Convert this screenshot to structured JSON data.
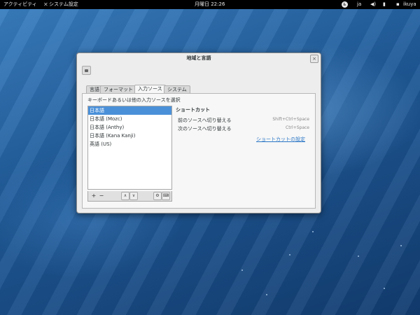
{
  "topbar": {
    "activities": "アクティビティ",
    "app_name": "システム設定",
    "clock": "月曜日 22:26",
    "input_lang": "ja",
    "user": "ikuya"
  },
  "window": {
    "title": "地域と言語",
    "close_glyph": "×"
  },
  "tabs": [
    {
      "label": "言語",
      "active": false
    },
    {
      "label": "フォーマット",
      "active": false
    },
    {
      "label": "入力ソース",
      "active": true
    },
    {
      "label": "システム",
      "active": false
    }
  ],
  "input_sources": {
    "instruction": "キーボードあるいは他の入力ソースを選択",
    "items": [
      {
        "label": "日本語",
        "selected": true
      },
      {
        "label": "日本語 (Mozc)",
        "selected": false
      },
      {
        "label": "日本語 (Anthy)",
        "selected": false
      },
      {
        "label": "日本語 (Kana Kanji)",
        "selected": false
      },
      {
        "label": "英語 (US)",
        "selected": false
      }
    ],
    "toolbar": {
      "add": "+",
      "remove": "−",
      "move_up": "∧",
      "move_down": "∨",
      "settings": "⚙",
      "layout": "⌨"
    }
  },
  "shortcuts": {
    "heading": "ショートカット",
    "prev_label": "前のソースへ切り替える",
    "prev_key": "Shift+Ctrl+Space",
    "next_label": "次のソースへ切り替える",
    "next_key": "Ctrl+Space",
    "settings_link": "ショートカットの設定"
  },
  "colors": {
    "selection": "#4a90d9",
    "link": "#2a76c6",
    "topbar": "#000000"
  }
}
